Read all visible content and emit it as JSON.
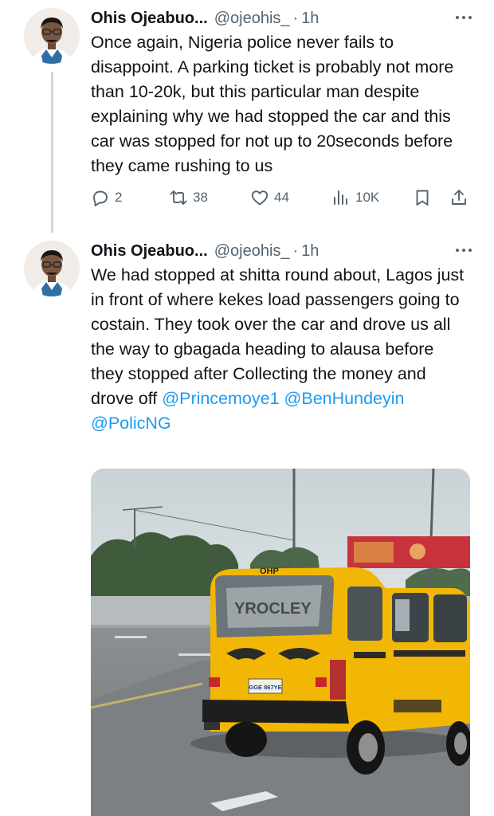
{
  "tweets": [
    {
      "author_name": "Ohis Ojeabuo...",
      "handle": "@ojeohis_",
      "separator": "·",
      "time": "1h",
      "text": "Once again, Nigeria police never fails to disappoint. A parking ticket is probably not more than 10-20k, but this particular man despite explaining why we had stopped the car and this car was stopped for not up to 20seconds before they came rushing to us",
      "replies": "2",
      "retweets": "38",
      "likes": "44",
      "views": "10K"
    },
    {
      "author_name": "Ohis Ojeabuo...",
      "handle": "@ojeohis_",
      "separator": "·",
      "time": "1h",
      "text": "We had stopped at shitta round about, Lagos just in front of where kekes load passengers going to costain. They took over the car and drove us all the way to gbagada heading to alausa before they stopped after Collecting the money and drove off ",
      "mentions": [
        "@Princemoye1",
        "@BenHundeyin",
        "@PolicNG"
      ],
      "media": {
        "vehicle_rear_text": "OHP",
        "plate": "GGE 867YE",
        "billboard_color": "#c8323a",
        "bus_color": "#f2b705"
      }
    }
  ],
  "colors": {
    "text": "#0f1419",
    "muted": "#536471",
    "link": "#1d9bf0",
    "thread": "#cfd9de"
  },
  "icons": [
    "avatar",
    "more-icon",
    "reply-icon",
    "retweet-icon",
    "like-icon",
    "views-icon",
    "bookmark-icon",
    "share-icon"
  ]
}
